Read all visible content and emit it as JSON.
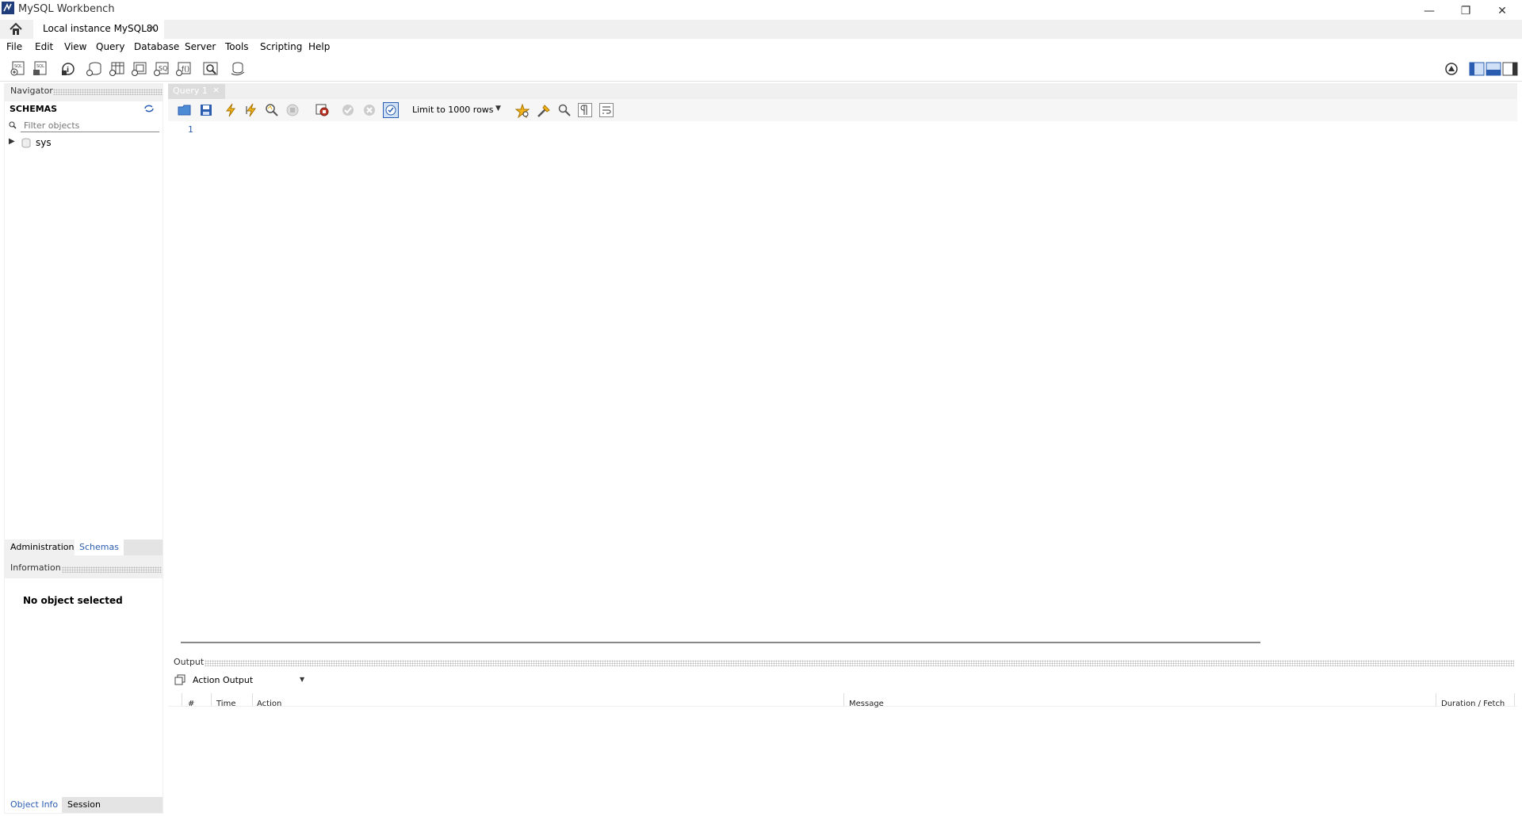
{
  "window": {
    "title": "MySQL Workbench"
  },
  "tabs": {
    "home_icon": "home-icon",
    "connection": "Local instance MySQL80"
  },
  "menu": [
    "File",
    "Edit",
    "View",
    "Query",
    "Database",
    "Server",
    "Tools",
    "Scripting",
    "Help"
  ],
  "navigator": {
    "header": "Navigator",
    "schemas_title": "SCHEMAS",
    "filter_placeholder": "Filter objects",
    "schemas": [
      "sys"
    ],
    "bottom_tabs": [
      "Administration",
      "Schemas"
    ]
  },
  "information": {
    "header": "Information",
    "message": "No object selected",
    "bottom_tabs": [
      "Object Info",
      "Session"
    ]
  },
  "editor": {
    "tab": "Query 1",
    "limit": "Limit to 1000 rows",
    "line_numbers": [
      "1"
    ]
  },
  "output": {
    "header": "Output",
    "selector": "Action Output",
    "columns": [
      "#",
      "Time",
      "Action",
      "Message",
      "Duration / Fetch"
    ]
  },
  "colors": {
    "accent": "#2a5db0",
    "panel_bg": "#f0f0f0"
  }
}
